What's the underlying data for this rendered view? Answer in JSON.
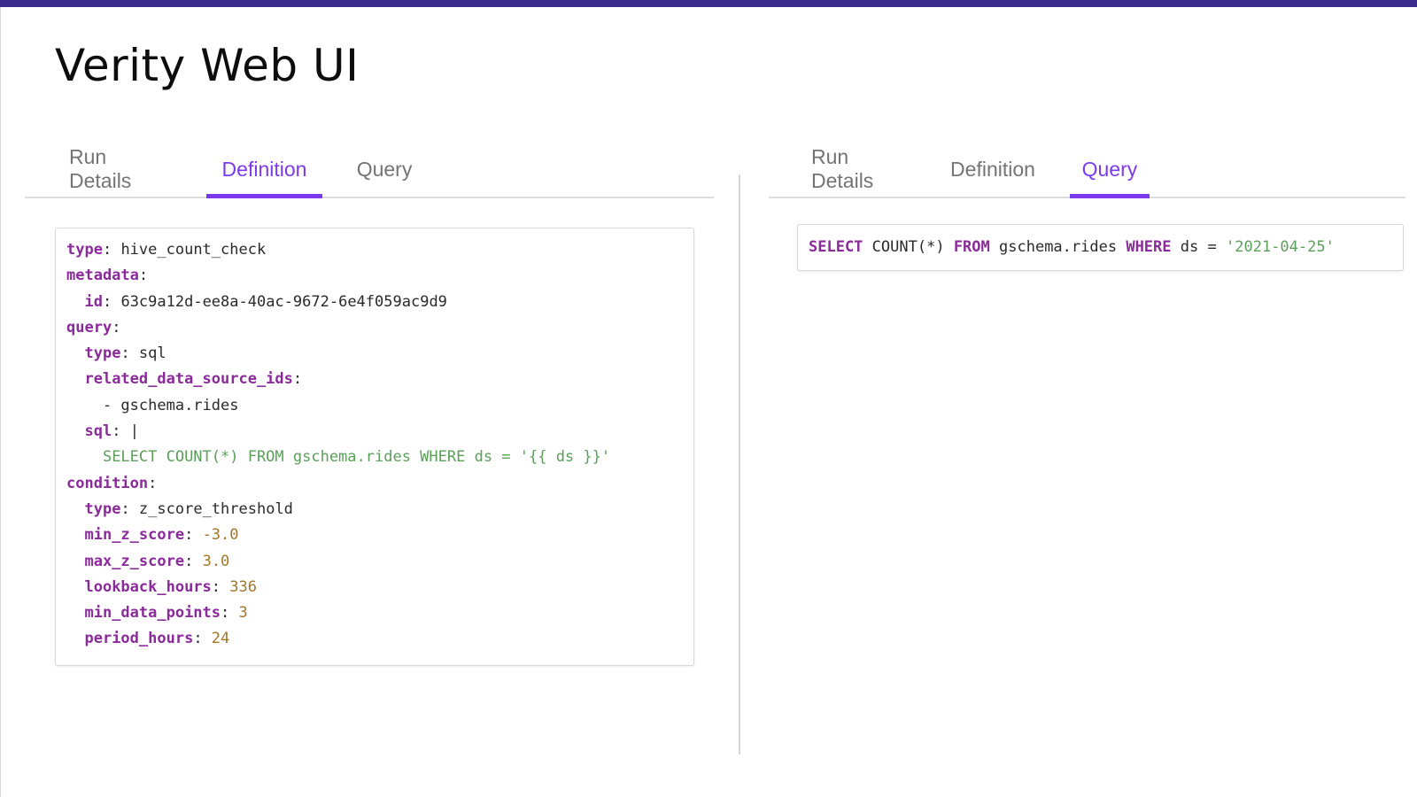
{
  "page": {
    "title": "Verity Web UI",
    "accent_color": "#7c3aed",
    "top_bar_color": "#3a2a8a"
  },
  "left_pane": {
    "tabs": [
      {
        "label": "Run Details",
        "active": false
      },
      {
        "label": "Definition",
        "active": true
      },
      {
        "label": "Query",
        "active": false
      }
    ],
    "definition": {
      "type_key": "type",
      "type_value": "hive_count_check",
      "metadata_key": "metadata",
      "id_key": "id",
      "id_value": "63c9a12d-ee8a-40ac-9672-6e4f059ac9d9",
      "query_key": "query",
      "query_type_key": "type",
      "query_type_value": "sql",
      "related_key": "related_data_source_ids",
      "related_item": "- gschema.rides",
      "sql_key": "sql",
      "sql_indicator": "|",
      "sql_value": "SELECT COUNT(*) FROM gschema.rides WHERE ds = '{{ ds }}'",
      "condition_key": "condition",
      "condition_type_key": "type",
      "condition_type_value": "z_score_threshold",
      "min_z_key": "min_z_score",
      "min_z_value": "-3.0",
      "max_z_key": "max_z_score",
      "max_z_value": "3.0",
      "lookback_key": "lookback_hours",
      "lookback_value": "336",
      "min_points_key": "min_data_points",
      "min_points_value": "3",
      "period_key": "period_hours",
      "period_value": "24"
    }
  },
  "right_pane": {
    "tabs": [
      {
        "label": "Run Details",
        "active": false
      },
      {
        "label": "Definition",
        "active": false
      },
      {
        "label": "Query",
        "active": true
      }
    ],
    "query": {
      "select_kw": "SELECT",
      "count_expr": "COUNT(*)",
      "from_kw": "FROM",
      "table": "gschema.rides",
      "where_kw": "WHERE",
      "column": "ds",
      "operator": "=",
      "value": "'2021-04-25'"
    }
  }
}
